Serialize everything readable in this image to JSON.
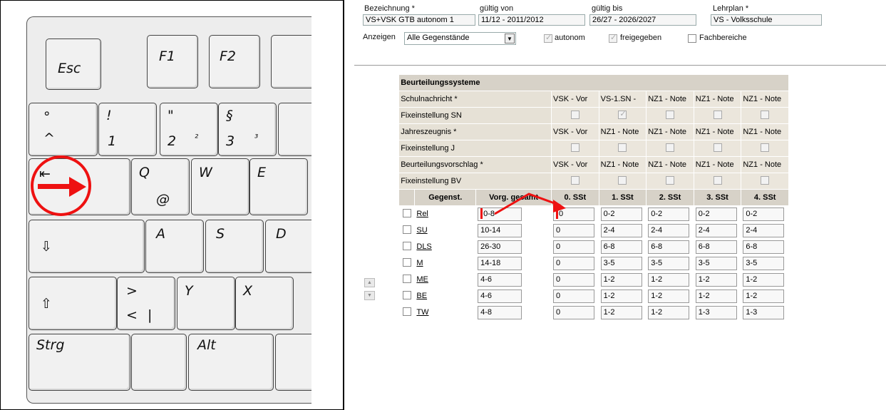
{
  "keyboard": {
    "keys": {
      "esc": "Esc",
      "f1": "F1",
      "f2": "F2",
      "degree": "°",
      "caret": "^",
      "excl": "!",
      "one": "1",
      "quote": "\"",
      "two": "2",
      "sup2": "²",
      "section": "§",
      "three": "3",
      "sup3": "³",
      "q": "Q",
      "at": "@",
      "w": "W",
      "e": "E",
      "a": "A",
      "s": "S",
      "d_partial": "D",
      "gt": ">",
      "lt": "<",
      "pipe": "|",
      "y": "Y",
      "x": "X",
      "strg": "Strg",
      "alt": "Alt"
    },
    "icons": [
      "tab-icon",
      "caps-lock-icon",
      "shift-icon"
    ],
    "annotation_color": "#ee1111"
  },
  "form": {
    "bezeichnung_label": "Bezeichnung *",
    "bezeichnung_value": "VS+VSK GTB autonom 1",
    "gueltig_von_label": "gültig von",
    "gueltig_von_value": "11/12 - 2011/2012",
    "gueltig_bis_label": "gültig bis",
    "gueltig_bis_value": "26/27 - 2026/2027",
    "lehrplan_label": "Lehrplan *",
    "lehrplan_value": "VS - Volksschule",
    "anzeigen_label": "Anzeigen",
    "anzeigen_value": "Alle Gegenstände",
    "autonom_label": "autonom",
    "freigegeben_label": "freigegeben",
    "fachbereiche_label": "Fachbereiche"
  },
  "table": {
    "title": "Beurteilungssysteme",
    "setting_rows": [
      {
        "label": "Schulnachricht *",
        "values": [
          "VSK - Vor",
          "VS-1.SN -",
          "NZ1 - Note",
          "NZ1 - Note",
          "NZ1 - Note"
        ]
      },
      {
        "label": "Fixeinstellung SN",
        "checks": [
          false,
          true,
          false,
          false,
          false
        ]
      },
      {
        "label": "Jahreszeugnis *",
        "values": [
          "VSK - Vor",
          "NZ1 - Note",
          "NZ1 - Note",
          "NZ1 - Note",
          "NZ1 - Note"
        ]
      },
      {
        "label": "Fixeinstellung J",
        "checks": [
          false,
          false,
          false,
          false,
          false
        ]
      },
      {
        "label": "Beurteilungsvorschlag *",
        "values": [
          "VSK - Vor",
          "NZ1 - Note",
          "NZ1 - Note",
          "NZ1 - Note",
          "NZ1 - Note"
        ]
      },
      {
        "label": "Fixeinstellung BV",
        "checks": [
          false,
          false,
          false,
          false,
          false
        ]
      }
    ],
    "columns": [
      "Gegenst.",
      "Vorg. gesamt",
      "0. SSt",
      "1. SSt",
      "2. SSt",
      "3. SSt",
      "4. SSt"
    ],
    "rows": [
      {
        "subject": "Rel",
        "total": "0-8",
        "values": [
          "0",
          "0-2",
          "0-2",
          "0-2",
          "0-2"
        ]
      },
      {
        "subject": "SU",
        "total": "10-14",
        "values": [
          "0",
          "2-4",
          "2-4",
          "2-4",
          "2-4"
        ]
      },
      {
        "subject": "DLS",
        "total": "26-30",
        "values": [
          "0",
          "6-8",
          "6-8",
          "6-8",
          "6-8"
        ]
      },
      {
        "subject": "M",
        "total": "14-18",
        "values": [
          "0",
          "3-5",
          "3-5",
          "3-5",
          "3-5"
        ]
      },
      {
        "subject": "ME",
        "total": "4-6",
        "values": [
          "0",
          "1-2",
          "1-2",
          "1-2",
          "1-2"
        ]
      },
      {
        "subject": "BE",
        "total": "4-6",
        "values": [
          "0",
          "1-2",
          "1-2",
          "1-2",
          "1-2"
        ]
      },
      {
        "subject": "TW",
        "total": "4-8",
        "values": [
          "0",
          "1-2",
          "1-2",
          "1-3",
          "1-3"
        ]
      }
    ]
  }
}
